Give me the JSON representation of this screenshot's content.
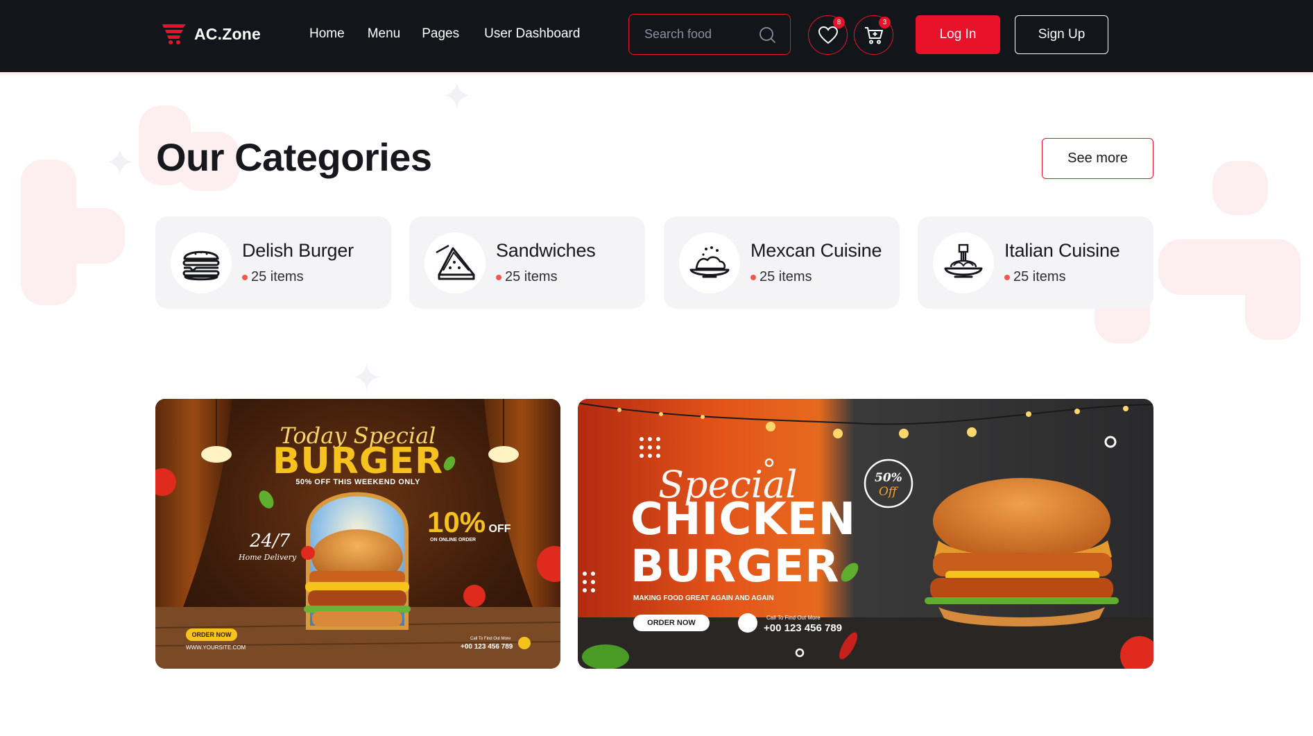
{
  "brand": {
    "name": "AC.Zone",
    "accent": "#e8132a",
    "header_bg": "#12151a"
  },
  "nav": {
    "items": [
      "Home",
      "Menu",
      "Pages",
      "User Dashboard"
    ]
  },
  "search": {
    "placeholder": "Search food"
  },
  "header_actions": {
    "favorites_count": "8",
    "cart_count": "3",
    "login_label": "Log In",
    "signup_label": "Sign Up"
  },
  "categories": {
    "title": "Our Categories",
    "see_more_label": "See more",
    "items": [
      {
        "name": "Delish Burger",
        "count": "25 items",
        "icon": "burger-icon"
      },
      {
        "name": "Sandwiches",
        "count": "25 items",
        "icon": "sandwich-icon"
      },
      {
        "name": "Mexcan Cuisine",
        "count": "25 items",
        "icon": "mexican-dish-icon"
      },
      {
        "name": "Italian Cuisine",
        "count": "25 items",
        "icon": "pasta-icon"
      }
    ]
  },
  "banners": {
    "left": {
      "script": "Today Special",
      "headline": "BURGER",
      "subline": "50% OFF THIS WEEKEND ONLY",
      "offer_big": "10%",
      "offer_small": "OFF",
      "offer_note": "ON ONLINE ORDER",
      "delivery_big": "24/7",
      "delivery_small": "Home Delivery",
      "cta": "ORDER NOW",
      "site": "WWW.YOURSITE.COM",
      "call_note": "Call To Find Out More",
      "phone": "+00 123 456 789"
    },
    "right": {
      "script": "Special",
      "headline_1": "CHICKEN",
      "headline_2": "BURGER",
      "tagline": "MAKING FOOD GREAT AGAIN AND AGAIN",
      "cta": "ORDER NOW",
      "call_note": "Call To Find Out More",
      "phone": "+00 123 456 789",
      "badge_big": "50%",
      "badge_small": "Off"
    }
  }
}
